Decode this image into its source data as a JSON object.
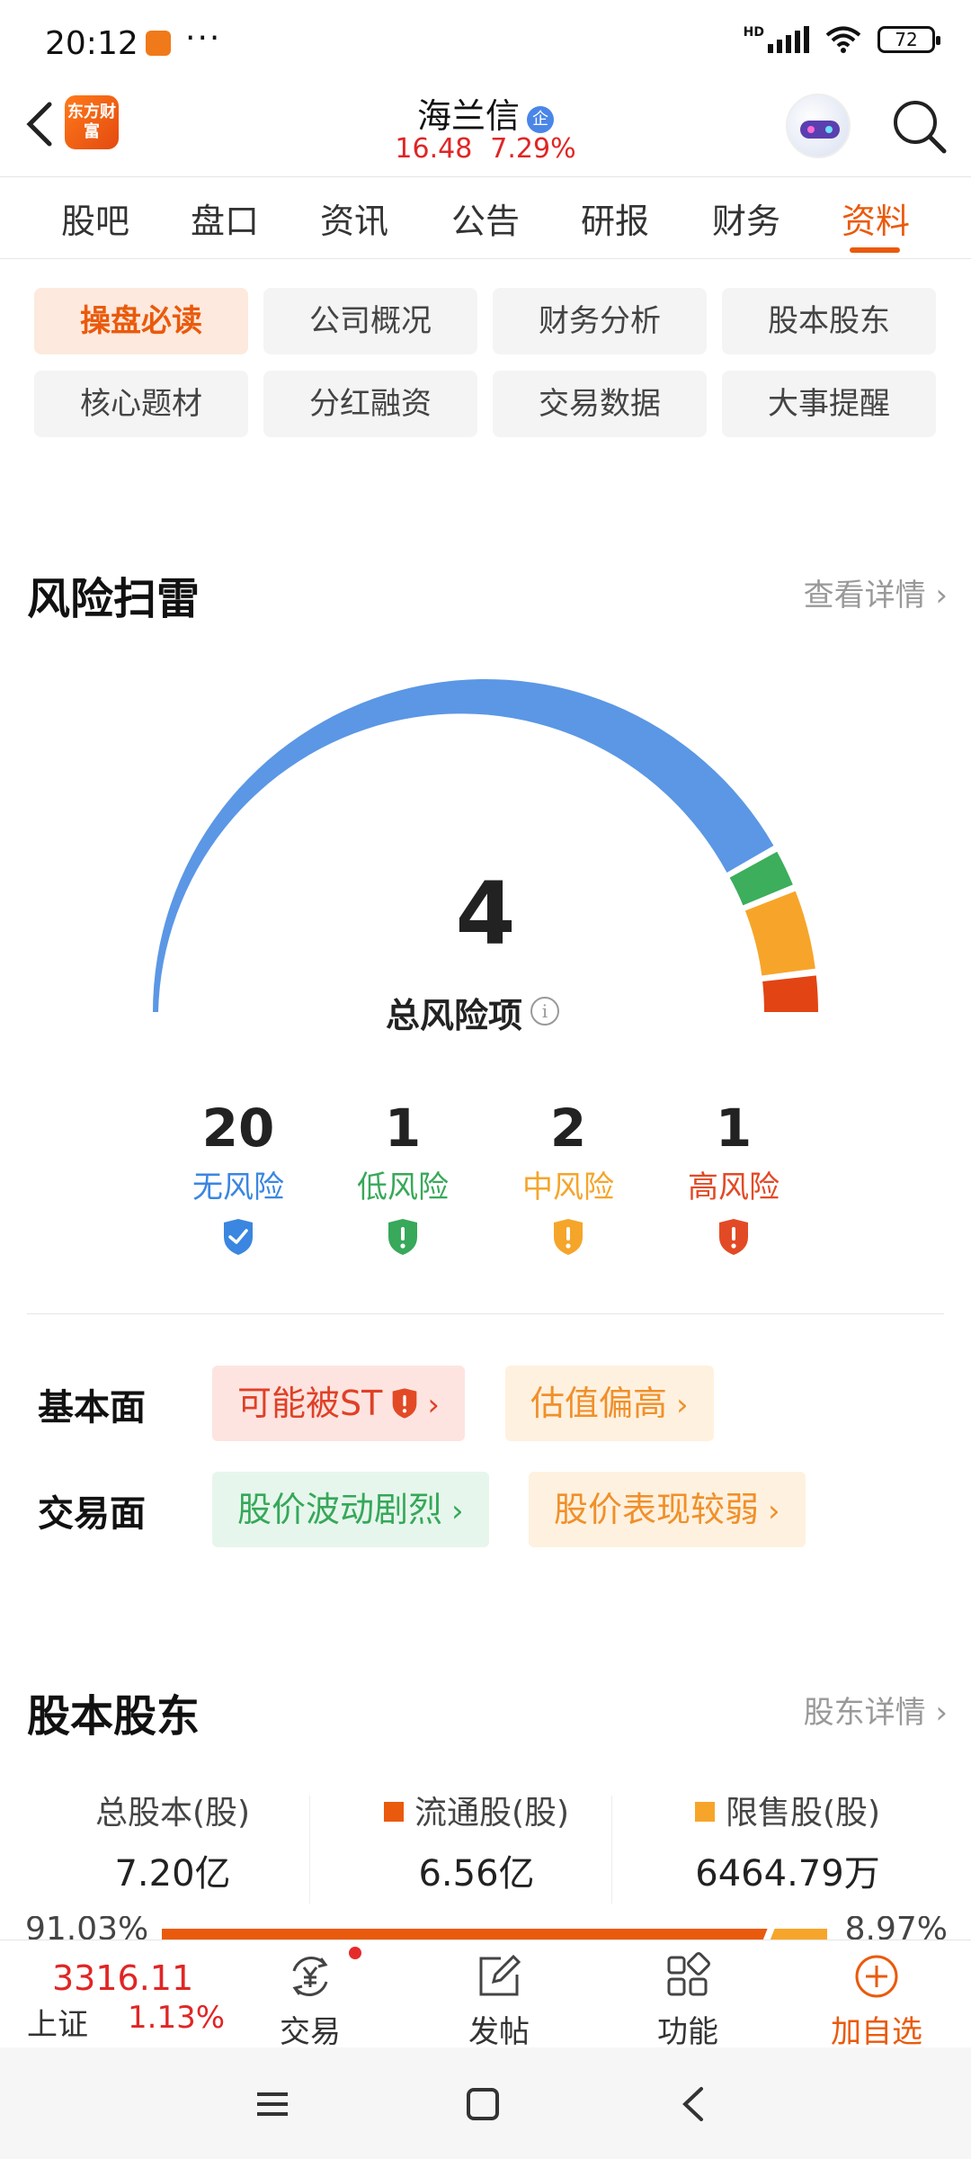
{
  "status_bar": {
    "time": "20:12",
    "network_label": "HD",
    "battery": "72"
  },
  "header": {
    "logo_text": "东方财富",
    "stock_name": "海兰信",
    "corp_badge": "企",
    "price": "16.48",
    "change_pct": "7.29%"
  },
  "tabs": [
    {
      "label": "股吧"
    },
    {
      "label": "盘口"
    },
    {
      "label": "资讯"
    },
    {
      "label": "公告"
    },
    {
      "label": "研报"
    },
    {
      "label": "财务"
    },
    {
      "label": "资料",
      "active": true
    }
  ],
  "chips": [
    {
      "label": "操盘必读",
      "active": true
    },
    {
      "label": "公司概况"
    },
    {
      "label": "财务分析"
    },
    {
      "label": "股本股东"
    },
    {
      "label": "核心题材"
    },
    {
      "label": "分红融资"
    },
    {
      "label": "交易数据"
    },
    {
      "label": "大事提醒"
    }
  ],
  "risk": {
    "title": "风险扫雷",
    "more": "查看详情",
    "total": "4",
    "total_label": "总风险项",
    "colors": {
      "none": "#5b97e5",
      "low": "#3cae5c",
      "mid": "#f7a52a",
      "high": "#e24414"
    },
    "stats": [
      {
        "count": "20",
        "label": "无风险",
        "color": "#3a86e0",
        "icon": "shield-check-icon"
      },
      {
        "count": "1",
        "label": "低风险",
        "color": "#38a85a",
        "icon": "shield-alert-icon"
      },
      {
        "count": "2",
        "label": "中风险",
        "color": "#f5a52a",
        "icon": "shield-alert-icon"
      },
      {
        "count": "1",
        "label": "高风险",
        "color": "#e24a26",
        "icon": "shield-alert-icon"
      }
    ],
    "fundamental_label": "基本面",
    "fundamental_tags": [
      {
        "label": "可能被ST",
        "level": "high"
      },
      {
        "label": "估值偏高",
        "level": "mid"
      }
    ],
    "trading_label": "交易面",
    "trading_tags": [
      {
        "label": "股价波动剧烈",
        "level": "low"
      },
      {
        "label": "股价表现较弱",
        "level": "mid"
      }
    ]
  },
  "shareholders": {
    "title": "股本股东",
    "more": "股东详情",
    "total_label": "总股本(股)",
    "total_value": "7.20亿",
    "float_label": "流通股(股)",
    "float_value": "6.56亿",
    "restricted_label": "限售股(股)",
    "restricted_value": "6464.79万",
    "float_pct": "91.03%",
    "restricted_pct": "8.97%",
    "float_color": "#ea5a0c",
    "restricted_color": "#f7a52a"
  },
  "bottom_nav": {
    "index_value": "3316.11",
    "index_name": "上证",
    "index_change": "1.13%",
    "items": [
      {
        "label": "交易"
      },
      {
        "label": "发帖"
      },
      {
        "label": "功能"
      },
      {
        "label": "加自选"
      }
    ]
  }
}
